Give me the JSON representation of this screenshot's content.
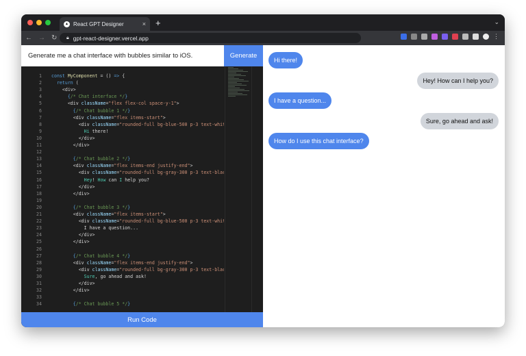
{
  "browser": {
    "tab_title": "React GPT Designer",
    "url": "gpt-react-designer.vercel.app",
    "new_tab": "+",
    "close": "×"
  },
  "prompt": {
    "value": "Generate me a chat interface with bubbles similar to iOS.",
    "generate_label": "Generate"
  },
  "run_label": "Run Code",
  "code": [
    [
      [
        "kw",
        "const "
      ],
      [
        "fn",
        "MyComponent"
      ],
      [
        "txt",
        " = () "
      ],
      [
        "kw",
        "=>"
      ],
      [
        "txt",
        " {"
      ]
    ],
    [
      [
        "kw",
        "  return"
      ],
      [
        "txt",
        " ("
      ]
    ],
    [
      [
        "tag",
        "    <div>"
      ]
    ],
    [
      [
        "kw",
        "      {"
      ],
      [
        "cm",
        "/* Chat interface */"
      ],
      [
        "kw",
        "}"
      ]
    ],
    [
      [
        "tag",
        "      <div "
      ],
      [
        "attr",
        "className"
      ],
      [
        "txt",
        "="
      ],
      [
        "str",
        "\"flex flex-col space-y-1\""
      ],
      [
        "tag",
        ">"
      ]
    ],
    [
      [
        "kw",
        "        {"
      ],
      [
        "cm",
        "/* Chat bubble 1 */"
      ],
      [
        "kw",
        "}"
      ]
    ],
    [
      [
        "tag",
        "        <div "
      ],
      [
        "attr",
        "className"
      ],
      [
        "txt",
        "="
      ],
      [
        "str",
        "\"flex items-start\""
      ],
      [
        "tag",
        ">"
      ]
    ],
    [
      [
        "tag",
        "          <div "
      ],
      [
        "attr",
        "className"
      ],
      [
        "txt",
        "="
      ],
      [
        "str",
        "\"rounded-full bg-blue-500 p-3 text-white\""
      ]
    ],
    [
      [
        "jsx",
        "            Hi"
      ],
      [
        "txt",
        " there!"
      ]
    ],
    [
      [
        "tag",
        "          </div>"
      ]
    ],
    [
      [
        "tag",
        "        </div>"
      ]
    ],
    [
      [
        "txt",
        ""
      ]
    ],
    [
      [
        "kw",
        "        {"
      ],
      [
        "cm",
        "/* Chat bubble 2 */"
      ],
      [
        "kw",
        "}"
      ]
    ],
    [
      [
        "tag",
        "        <div "
      ],
      [
        "attr",
        "className"
      ],
      [
        "txt",
        "="
      ],
      [
        "str",
        "\"flex items-end justify-end\""
      ],
      [
        "tag",
        ">"
      ]
    ],
    [
      [
        "tag",
        "          <div "
      ],
      [
        "attr",
        "className"
      ],
      [
        "txt",
        "="
      ],
      [
        "str",
        "\"rounded-full bg-gray-300 p-3 text-black\""
      ]
    ],
    [
      [
        "jsx",
        "            Hey"
      ],
      [
        "txt",
        "! "
      ],
      [
        "jsx",
        "How"
      ],
      [
        "txt",
        " can "
      ],
      [
        "jsx",
        "I"
      ],
      [
        "txt",
        " help you?"
      ]
    ],
    [
      [
        "tag",
        "          </div>"
      ]
    ],
    [
      [
        "tag",
        "        </div>"
      ]
    ],
    [
      [
        "txt",
        ""
      ]
    ],
    [
      [
        "kw",
        "        {"
      ],
      [
        "cm",
        "/* Chat bubble 3 */"
      ],
      [
        "kw",
        "}"
      ]
    ],
    [
      [
        "tag",
        "        <div "
      ],
      [
        "attr",
        "className"
      ],
      [
        "txt",
        "="
      ],
      [
        "str",
        "\"flex items-start\""
      ],
      [
        "tag",
        ">"
      ]
    ],
    [
      [
        "tag",
        "          <div "
      ],
      [
        "attr",
        "className"
      ],
      [
        "txt",
        "="
      ],
      [
        "str",
        "\"rounded-full bg-blue-500 p-3 text-white\""
      ]
    ],
    [
      [
        "txt",
        "            I have a question..."
      ]
    ],
    [
      [
        "tag",
        "          </div>"
      ]
    ],
    [
      [
        "tag",
        "        </div>"
      ]
    ],
    [
      [
        "txt",
        ""
      ]
    ],
    [
      [
        "kw",
        "        {"
      ],
      [
        "cm",
        "/* Chat bubble 4 */"
      ],
      [
        "kw",
        "}"
      ]
    ],
    [
      [
        "tag",
        "        <div "
      ],
      [
        "attr",
        "className"
      ],
      [
        "txt",
        "="
      ],
      [
        "str",
        "\"flex items-end justify-end\""
      ],
      [
        "tag",
        ">"
      ]
    ],
    [
      [
        "tag",
        "          <div "
      ],
      [
        "attr",
        "className"
      ],
      [
        "txt",
        "="
      ],
      [
        "str",
        "\"rounded-full bg-gray-300 p-3 text-black\""
      ]
    ],
    [
      [
        "jsx",
        "            Sure"
      ],
      [
        "txt",
        ", go ahead and ask!"
      ]
    ],
    [
      [
        "tag",
        "          </div>"
      ]
    ],
    [
      [
        "tag",
        "        </div>"
      ]
    ],
    [
      [
        "txt",
        ""
      ]
    ],
    [
      [
        "kw",
        "        {"
      ],
      [
        "cm",
        "/* Chat bubble 5 */"
      ],
      [
        "kw",
        "}"
      ]
    ]
  ],
  "chat": [
    {
      "text": "Hi there!",
      "side": "left"
    },
    {
      "text": "Hey! How can I help you?",
      "side": "right"
    },
    {
      "text": "I have a question...",
      "side": "left"
    },
    {
      "text": "Sure, go ahead and ask!",
      "side": "right"
    },
    {
      "text": "How do I use this chat interface?",
      "side": "left"
    }
  ]
}
